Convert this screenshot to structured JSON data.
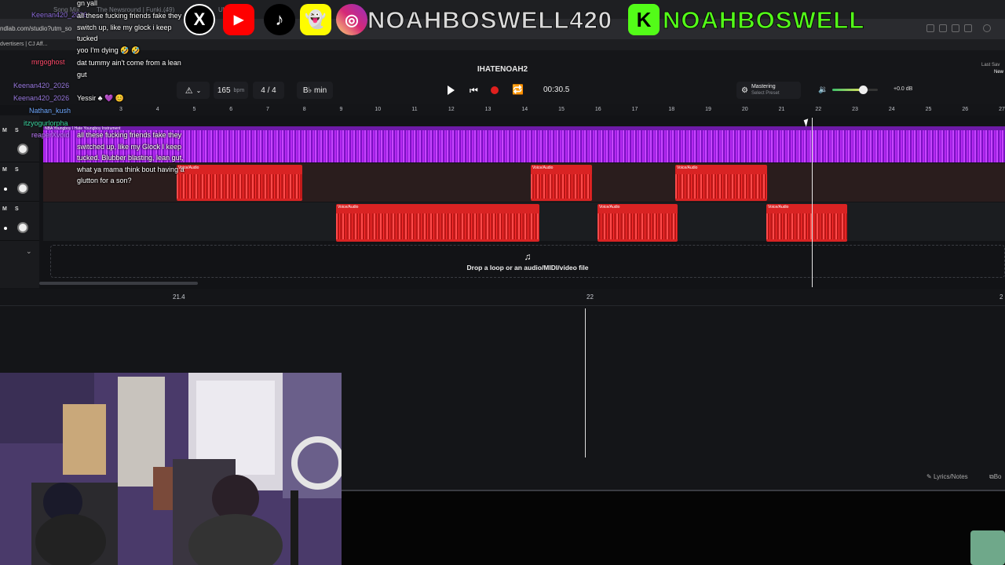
{
  "browser": {
    "tabs": [
      "Song Mix",
      "The Newsround | Funki…",
      "(49)",
      "Ul"
    ],
    "url": "ndlab.com/studio?utm_so",
    "bookmark": "dvertisers | CJ Aff..."
  },
  "overlay": {
    "handle1": "NOAHBOSWELL420",
    "handle2": "NOAHBOSWELL",
    "kick_letter": "K",
    "x_letter": "X",
    "colors": {
      "handle1": "#d9d9d9",
      "handle2": "#53fc18",
      "youtube": "#ff0000",
      "snapchat": "#fffc00"
    }
  },
  "chat": {
    "messages": [
      {
        "user": "",
        "text": "gn yall"
      },
      {
        "user": "Keenan420_2026",
        "text": "all these fucking friends fake they switch up, like my glock i keep tucked"
      },
      {
        "user": "",
        "text": "yoo I'm dying 🤣 🤣"
      },
      {
        "user": "mrgoghost",
        "text": "dat tummy ain't come from a lean gut"
      },
      {
        "user": "Keenan420_2026",
        "text": "Yessir ♣ 💜 😊"
      },
      {
        "user": "Nathan_kush",
        "text": ""
      },
      {
        "user": "itzyogurlorpha",
        "text": ""
      },
      {
        "user": "reaperXvoid",
        "text": "all these fucking friends fake they switched up, like my Glock I keep tucked. Blubber blasting, lean gut, what ya mama think bout having a glutton for a son?"
      }
    ]
  },
  "daw": {
    "project_name": "IHATENOAH2",
    "bpm": "165",
    "bpm_unit": "bpm",
    "time_signature": "4 / 4",
    "key": "B♭ min",
    "position": "00:30.5",
    "mastering_label": "Mastering",
    "mastering_sub": "Select Preset",
    "volume_db": "+0.0 dB",
    "last_saved": "Last Sav",
    "last_saved_sub": "New",
    "ruler": [
      "3",
      "4",
      "5",
      "6",
      "7",
      "8",
      "9",
      "10",
      "11",
      "12",
      "13",
      "14",
      "15",
      "16",
      "17",
      "18",
      "19",
      "20",
      "21",
      "22",
      "23",
      "24",
      "25",
      "26",
      "27"
    ],
    "track1_label": "NBA Youngboy I Hate Youngboy Instrument",
    "clip_label": "Voice/Audio",
    "drop_text": "Drop a loop or an audio/MIDI/video file",
    "editor_ruler": [
      "21.4",
      "22",
      "2"
    ],
    "lyrics_notes": "Lyrics/Notes",
    "bo": "Bo"
  }
}
